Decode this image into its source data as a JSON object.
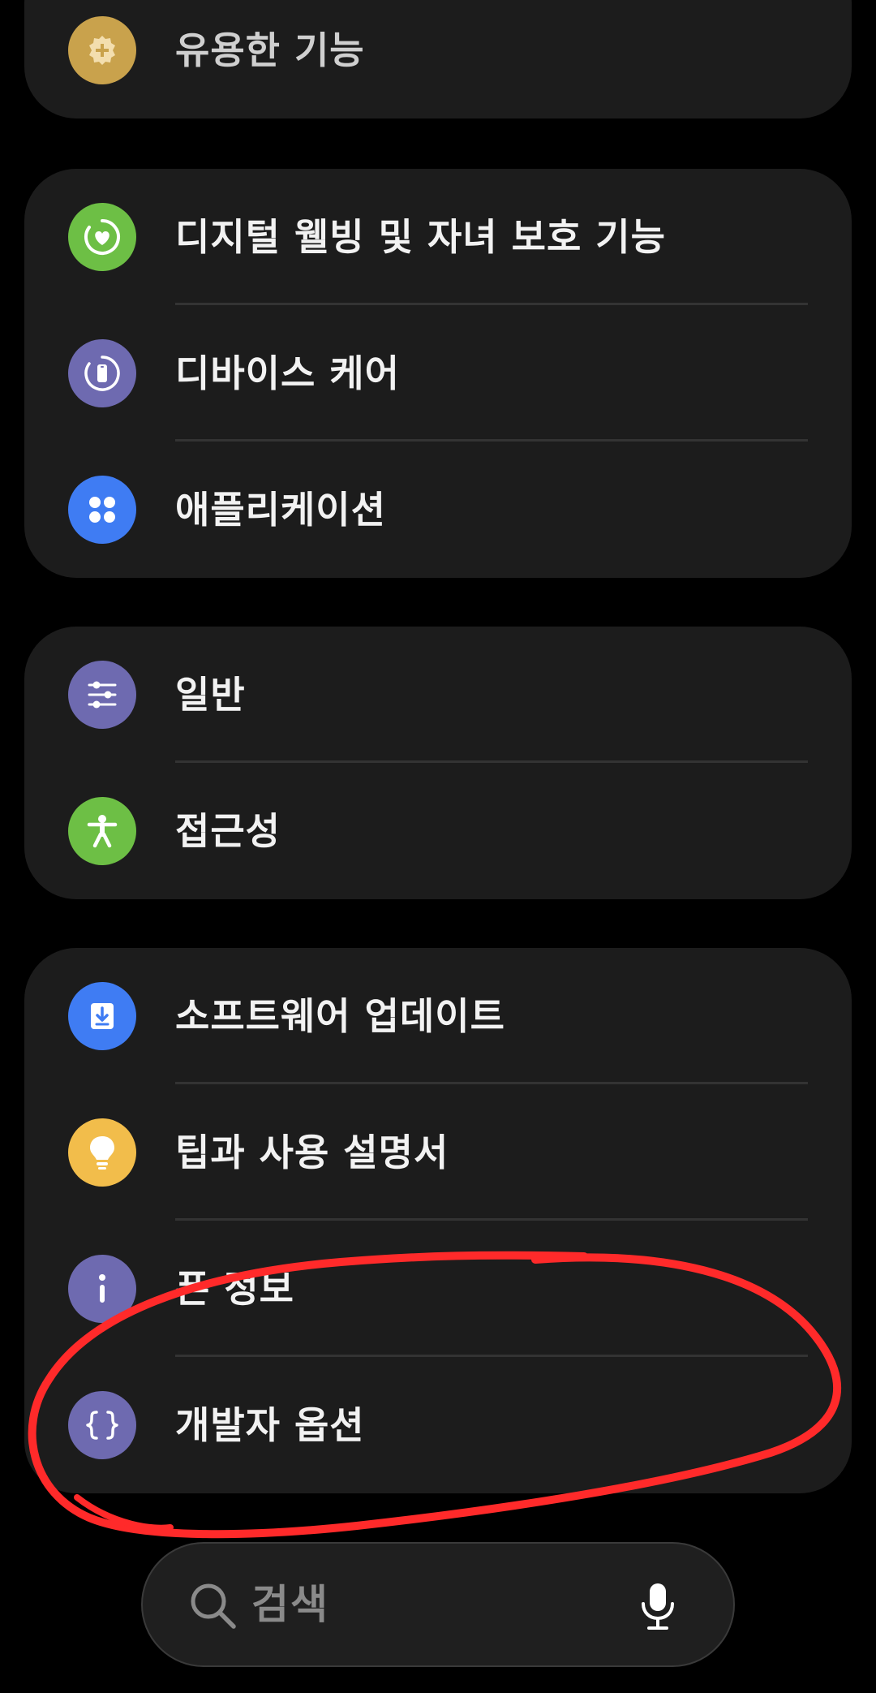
{
  "colors": {
    "background": "#000000",
    "card": "#1c1c1c",
    "annotation": "#ff2a2a"
  },
  "groups": [
    {
      "items": [
        {
          "label": "유용한 기능",
          "icon": "gear-plus-icon",
          "icon_color": "#c9a24c",
          "dim": true
        }
      ]
    },
    {
      "items": [
        {
          "label": "디지털 웰빙 및 자녀 보호 기능",
          "icon": "heart-ring-icon",
          "icon_color": "#6dbf45"
        },
        {
          "label": "디바이스 케어",
          "icon": "phone-care-icon",
          "icon_color": "#6e6ab0"
        },
        {
          "label": "애플리케이션",
          "icon": "apps-grid-icon",
          "icon_color": "#3f7cf3"
        }
      ]
    },
    {
      "items": [
        {
          "label": "일반",
          "icon": "sliders-icon",
          "icon_color": "#6e6ab0"
        },
        {
          "label": "접근성",
          "icon": "accessibility-icon",
          "icon_color": "#6dbf45"
        }
      ]
    },
    {
      "items": [
        {
          "label": "소프트웨어 업데이트",
          "icon": "download-icon",
          "icon_color": "#3f7cf3"
        },
        {
          "label": "팁과 사용 설명서",
          "icon": "lightbulb-icon",
          "icon_color": "#f2bd4b"
        },
        {
          "label": "폰 정보",
          "icon": "info-icon",
          "icon_color": "#6e6ab0"
        },
        {
          "label": "개발자 옵션",
          "icon": "braces-icon",
          "icon_color": "#6e6ab0"
        }
      ]
    }
  ],
  "search": {
    "placeholder": "검색",
    "icon": "search-icon",
    "voice_icon": "microphone-icon"
  }
}
